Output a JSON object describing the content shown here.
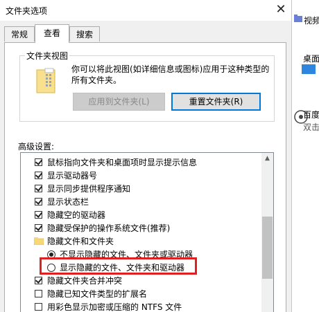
{
  "window": {
    "title": "文件夹选项",
    "close_icon": "close-icon"
  },
  "tabs": [
    {
      "label": "常规",
      "active": false
    },
    {
      "label": "查看",
      "active": true
    },
    {
      "label": "搜索",
      "active": false
    }
  ],
  "folder_views": {
    "legend": "文件夹视图",
    "description": "你可以将此视图(如详细信息或图标)应用于这种类型的所有文件夹。",
    "apply_button": "应用到文件夹(L)",
    "reset_button": "重置文件夹(R)"
  },
  "advanced": {
    "label": "高级设置:",
    "items": [
      {
        "type": "checkbox",
        "checked": true,
        "label": "鼠标指向文件夹和桌面项时显示提示信息"
      },
      {
        "type": "checkbox",
        "checked": true,
        "label": "显示驱动器号"
      },
      {
        "type": "checkbox",
        "checked": true,
        "label": "显示同步提供程序通知"
      },
      {
        "type": "checkbox",
        "checked": true,
        "label": "显示状态栏"
      },
      {
        "type": "checkbox",
        "checked": true,
        "label": "隐藏空的驱动器"
      },
      {
        "type": "checkbox",
        "checked": true,
        "label": "隐藏受保护的操作系统文件(推荐)"
      },
      {
        "type": "folder",
        "label": "隐藏文件和文件夹"
      },
      {
        "type": "radio",
        "checked": true,
        "label": "不显示隐藏的文件、文件夹或驱动器"
      },
      {
        "type": "radio",
        "checked": false,
        "label": "显示隐藏的文件、文件夹和驱动器"
      },
      {
        "type": "checkbox",
        "checked": true,
        "label": "隐藏文件夹合并冲突"
      },
      {
        "type": "checkbox",
        "checked": false,
        "label": "隐藏已知文件类型的扩展名"
      },
      {
        "type": "checkbox",
        "checked": false,
        "label": "用彩色显示加密或压缩的 NTFS 文件"
      }
    ]
  },
  "background": {
    "item1": "视频",
    "item2": "桌面",
    "item3": "百度",
    "item4": "双击"
  },
  "colors": {
    "highlight": "#e02020",
    "accent": "#0078d7"
  }
}
